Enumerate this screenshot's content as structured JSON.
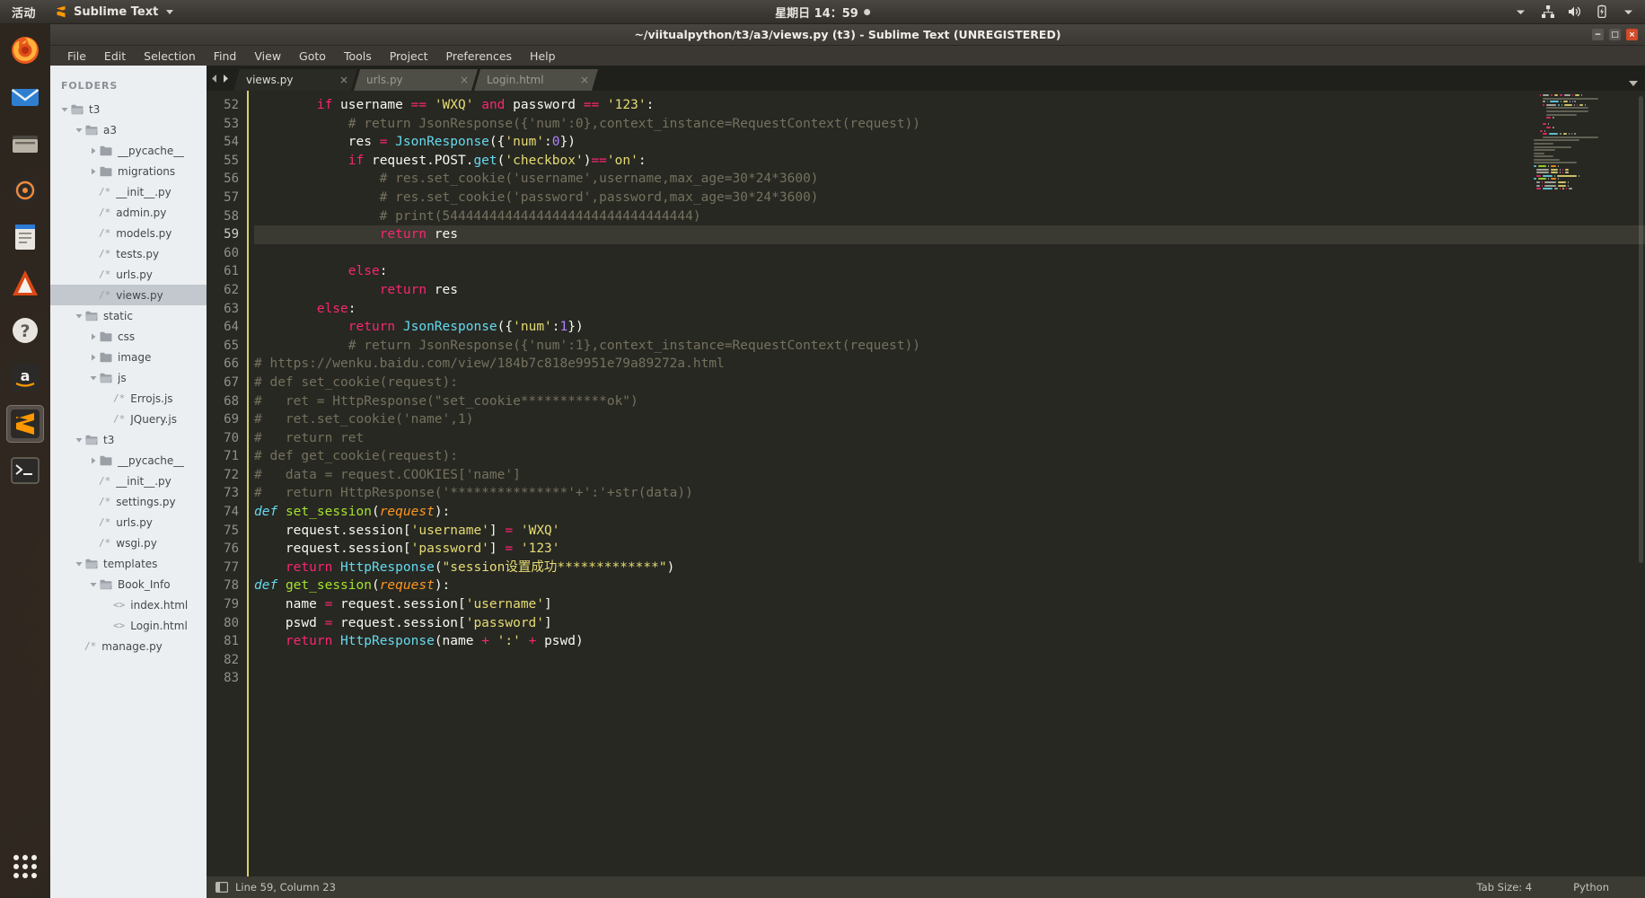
{
  "topbar": {
    "activities": "活动",
    "app_name": "Sublime Text",
    "clock": "星期日 14：59",
    "tray": [
      "chevron-down-icon",
      "network-icon",
      "volume-icon",
      "battery-icon",
      "chevron-down-icon"
    ]
  },
  "dock": {
    "items": [
      {
        "name": "firefox",
        "label": "Firefox"
      },
      {
        "name": "thunderbird",
        "label": "Thunderbird Mail"
      },
      {
        "name": "files",
        "label": "Files"
      },
      {
        "name": "rhythmbox",
        "label": "Rhythmbox"
      },
      {
        "name": "libreoffice-writer",
        "label": "LibreOffice Writer"
      },
      {
        "name": "ubuntu-software",
        "label": "Ubuntu Software"
      },
      {
        "name": "help",
        "label": "Help"
      },
      {
        "name": "amazon",
        "label": "Amazon"
      },
      {
        "name": "sublime-text",
        "label": "Sublime Text"
      },
      {
        "name": "terminal",
        "label": "Terminal"
      }
    ],
    "show_apps": "Show Applications"
  },
  "window": {
    "title": "~/viitualpython/t3/a3/views.py (t3) - Sublime Text (UNREGISTERED)",
    "minimize": "−",
    "maximize": "□",
    "close": "×"
  },
  "menu": [
    "File",
    "Edit",
    "Selection",
    "Find",
    "View",
    "Goto",
    "Tools",
    "Project",
    "Preferences",
    "Help"
  ],
  "sidebar": {
    "heading": "FOLDERS",
    "items": [
      {
        "label": "t3",
        "indent": 0,
        "type": "folder-open"
      },
      {
        "label": "a3",
        "indent": 1,
        "type": "folder-open"
      },
      {
        "label": "__pycache__",
        "indent": 2,
        "type": "folder"
      },
      {
        "label": "migrations",
        "indent": 2,
        "type": "folder"
      },
      {
        "label": "__init__.py",
        "indent": 2,
        "type": "file"
      },
      {
        "label": "admin.py",
        "indent": 2,
        "type": "file"
      },
      {
        "label": "models.py",
        "indent": 2,
        "type": "file"
      },
      {
        "label": "tests.py",
        "indent": 2,
        "type": "file"
      },
      {
        "label": "urls.py",
        "indent": 2,
        "type": "file"
      },
      {
        "label": "views.py",
        "indent": 2,
        "type": "file",
        "selected": true
      },
      {
        "label": "static",
        "indent": 1,
        "type": "folder-open"
      },
      {
        "label": "css",
        "indent": 2,
        "type": "folder"
      },
      {
        "label": "image",
        "indent": 2,
        "type": "folder"
      },
      {
        "label": "js",
        "indent": 2,
        "type": "folder-open"
      },
      {
        "label": "Errojs.js",
        "indent": 3,
        "type": "file"
      },
      {
        "label": "JQuery.js",
        "indent": 3,
        "type": "file"
      },
      {
        "label": "t3",
        "indent": 1,
        "type": "folder-open"
      },
      {
        "label": "__pycache__",
        "indent": 2,
        "type": "folder"
      },
      {
        "label": "__init__.py",
        "indent": 2,
        "type": "file"
      },
      {
        "label": "settings.py",
        "indent": 2,
        "type": "file"
      },
      {
        "label": "urls.py",
        "indent": 2,
        "type": "file"
      },
      {
        "label": "wsgi.py",
        "indent": 2,
        "type": "file"
      },
      {
        "label": "templates",
        "indent": 1,
        "type": "folder-open"
      },
      {
        "label": "Book_Info",
        "indent": 2,
        "type": "folder-open"
      },
      {
        "label": "index.html",
        "indent": 3,
        "type": "html"
      },
      {
        "label": "Login.html",
        "indent": 3,
        "type": "html"
      },
      {
        "label": "manage.py",
        "indent": 1,
        "type": "file"
      }
    ]
  },
  "tabs": [
    {
      "label": "views.py",
      "active": true,
      "close": "×"
    },
    {
      "label": "urls.py",
      "active": false,
      "close": "×"
    },
    {
      "label": "Login.html",
      "active": false,
      "close": "×"
    }
  ],
  "editor": {
    "first_line": 52,
    "cursor_line": 59,
    "lines": [
      {
        "n": 52,
        "tokens": [
          {
            "t": "        ",
            "c": "pl"
          },
          {
            "t": "if",
            "c": "k"
          },
          {
            "t": " username ",
            "c": "pl"
          },
          {
            "t": "==",
            "c": "op"
          },
          {
            "t": " ",
            "c": "pl"
          },
          {
            "t": "'WXQ'",
            "c": "str"
          },
          {
            "t": " ",
            "c": "pl"
          },
          {
            "t": "and",
            "c": "k"
          },
          {
            "t": " password ",
            "c": "pl"
          },
          {
            "t": "==",
            "c": "op"
          },
          {
            "t": " ",
            "c": "pl"
          },
          {
            "t": "'123'",
            "c": "str"
          },
          {
            "t": ":",
            "c": "pl"
          }
        ]
      },
      {
        "n": 53,
        "tokens": [
          {
            "t": "            # return JsonResponse({'num':0},context_instance=RequestContext(request))",
            "c": "cmt"
          }
        ]
      },
      {
        "n": 54,
        "tokens": [
          {
            "t": "            res ",
            "c": "pl"
          },
          {
            "t": "=",
            "c": "op"
          },
          {
            "t": " ",
            "c": "pl"
          },
          {
            "t": "JsonResponse",
            "c": "cls"
          },
          {
            "t": "({",
            "c": "pl"
          },
          {
            "t": "'num'",
            "c": "str"
          },
          {
            "t": ":",
            "c": "pl"
          },
          {
            "t": "0",
            "c": "num"
          },
          {
            "t": "})",
            "c": "pl"
          }
        ]
      },
      {
        "n": 55,
        "tokens": [
          {
            "t": "            ",
            "c": "pl"
          },
          {
            "t": "if",
            "c": "k"
          },
          {
            "t": " request.POST.",
            "c": "pl"
          },
          {
            "t": "get",
            "c": "cls"
          },
          {
            "t": "(",
            "c": "pl"
          },
          {
            "t": "'checkbox'",
            "c": "str"
          },
          {
            "t": ")",
            "c": "pl"
          },
          {
            "t": "==",
            "c": "op"
          },
          {
            "t": "'on'",
            "c": "str"
          },
          {
            "t": ":",
            "c": "pl"
          }
        ]
      },
      {
        "n": 56,
        "tokens": [
          {
            "t": "                # res.set_cookie('username',username,max_age=30*24*3600)",
            "c": "cmt"
          }
        ]
      },
      {
        "n": 57,
        "tokens": [
          {
            "t": "                # res.set_cookie('password',password,max_age=30*24*3600)",
            "c": "cmt"
          }
        ]
      },
      {
        "n": 58,
        "tokens": [
          {
            "t": "                # print(54444444444444444444444444444444)",
            "c": "cmt"
          }
        ]
      },
      {
        "n": 59,
        "hl": true,
        "tokens": [
          {
            "t": "                ",
            "c": "pl"
          },
          {
            "t": "return",
            "c": "k"
          },
          {
            "t": " res",
            "c": "pl"
          }
        ]
      },
      {
        "n": 60,
        "tokens": []
      },
      {
        "n": 61,
        "tokens": [
          {
            "t": "            ",
            "c": "pl"
          },
          {
            "t": "else",
            "c": "k"
          },
          {
            "t": ":",
            "c": "pl"
          }
        ]
      },
      {
        "n": 62,
        "tokens": [
          {
            "t": "                ",
            "c": "pl"
          },
          {
            "t": "return",
            "c": "k"
          },
          {
            "t": " res",
            "c": "pl"
          }
        ]
      },
      {
        "n": 63,
        "tokens": [
          {
            "t": "        ",
            "c": "pl"
          },
          {
            "t": "else",
            "c": "k"
          },
          {
            "t": ":",
            "c": "pl"
          }
        ]
      },
      {
        "n": 64,
        "tokens": [
          {
            "t": "            ",
            "c": "pl"
          },
          {
            "t": "return",
            "c": "k"
          },
          {
            "t": " ",
            "c": "pl"
          },
          {
            "t": "JsonResponse",
            "c": "cls"
          },
          {
            "t": "({",
            "c": "pl"
          },
          {
            "t": "'num'",
            "c": "str"
          },
          {
            "t": ":",
            "c": "pl"
          },
          {
            "t": "1",
            "c": "num"
          },
          {
            "t": "})",
            "c": "pl"
          }
        ]
      },
      {
        "n": 65,
        "tokens": [
          {
            "t": "            # return JsonResponse({'num':1},context_instance=RequestContext(request))",
            "c": "cmt"
          }
        ]
      },
      {
        "n": 66,
        "tokens": [
          {
            "t": "# https://wenku.baidu.com/view/184b7c818e9951e79a89272a.html",
            "c": "cmt"
          }
        ]
      },
      {
        "n": 67,
        "tokens": [
          {
            "t": "# def set_cookie(request):",
            "c": "cmt"
          }
        ]
      },
      {
        "n": 68,
        "tokens": [
          {
            "t": "#   ret = HttpResponse(\"set_cookie***********ok\")",
            "c": "cmt"
          }
        ]
      },
      {
        "n": 69,
        "tokens": [
          {
            "t": "#   ret.set_cookie('name',1)",
            "c": "cmt"
          }
        ]
      },
      {
        "n": 70,
        "tokens": [
          {
            "t": "#   return ret",
            "c": "cmt"
          }
        ]
      },
      {
        "n": 71,
        "tokens": [
          {
            "t": "# def get_cookie(request):",
            "c": "cmt"
          }
        ]
      },
      {
        "n": 72,
        "tokens": [
          {
            "t": "#   data = request.COOKIES['name']",
            "c": "cmt"
          }
        ]
      },
      {
        "n": 73,
        "tokens": [
          {
            "t": "#   return HttpResponse('***************'+':'+str(data))",
            "c": "cmt"
          }
        ]
      },
      {
        "n": 74,
        "tokens": [
          {
            "t": "def",
            "c": "kw2"
          },
          {
            "t": " ",
            "c": "pl"
          },
          {
            "t": "set_session",
            "c": "fn"
          },
          {
            "t": "(",
            "c": "pl"
          },
          {
            "t": "request",
            "c": "par"
          },
          {
            "t": "):",
            "c": "pl"
          }
        ]
      },
      {
        "n": 75,
        "tokens": [
          {
            "t": "    request.session[",
            "c": "pl"
          },
          {
            "t": "'username'",
            "c": "str"
          },
          {
            "t": "] ",
            "c": "pl"
          },
          {
            "t": "=",
            "c": "op"
          },
          {
            "t": " ",
            "c": "pl"
          },
          {
            "t": "'WXQ'",
            "c": "str"
          }
        ]
      },
      {
        "n": 76,
        "tokens": [
          {
            "t": "    request.session[",
            "c": "pl"
          },
          {
            "t": "'password'",
            "c": "str"
          },
          {
            "t": "] ",
            "c": "pl"
          },
          {
            "t": "=",
            "c": "op"
          },
          {
            "t": " ",
            "c": "pl"
          },
          {
            "t": "'123'",
            "c": "str"
          }
        ]
      },
      {
        "n": 77,
        "tokens": [
          {
            "t": "    ",
            "c": "pl"
          },
          {
            "t": "return",
            "c": "k"
          },
          {
            "t": " ",
            "c": "pl"
          },
          {
            "t": "HttpResponse",
            "c": "cls"
          },
          {
            "t": "(",
            "c": "pl"
          },
          {
            "t": "\"session设置成功*************\"",
            "c": "str"
          },
          {
            "t": ")",
            "c": "pl"
          }
        ]
      },
      {
        "n": 78,
        "tokens": [
          {
            "t": "def",
            "c": "kw2"
          },
          {
            "t": " ",
            "c": "pl"
          },
          {
            "t": "get_session",
            "c": "fn"
          },
          {
            "t": "(",
            "c": "pl"
          },
          {
            "t": "request",
            "c": "par"
          },
          {
            "t": "):",
            "c": "pl"
          }
        ]
      },
      {
        "n": 79,
        "tokens": [
          {
            "t": "    name ",
            "c": "pl"
          },
          {
            "t": "=",
            "c": "op"
          },
          {
            "t": " request.session[",
            "c": "pl"
          },
          {
            "t": "'username'",
            "c": "str"
          },
          {
            "t": "]",
            "c": "pl"
          }
        ]
      },
      {
        "n": 80,
        "tokens": [
          {
            "t": "    pswd ",
            "c": "pl"
          },
          {
            "t": "=",
            "c": "op"
          },
          {
            "t": " request.session[",
            "c": "pl"
          },
          {
            "t": "'password'",
            "c": "str"
          },
          {
            "t": "]",
            "c": "pl"
          }
        ]
      },
      {
        "n": 81,
        "tokens": [
          {
            "t": "    ",
            "c": "pl"
          },
          {
            "t": "return",
            "c": "k"
          },
          {
            "t": " ",
            "c": "pl"
          },
          {
            "t": "HttpResponse",
            "c": "cls"
          },
          {
            "t": "(name ",
            "c": "pl"
          },
          {
            "t": "+",
            "c": "op"
          },
          {
            "t": " ",
            "c": "pl"
          },
          {
            "t": "':'",
            "c": "str"
          },
          {
            "t": " ",
            "c": "pl"
          },
          {
            "t": "+",
            "c": "op"
          },
          {
            "t": " pswd)",
            "c": "pl"
          }
        ]
      },
      {
        "n": 82,
        "tokens": []
      },
      {
        "n": 83,
        "tokens": []
      }
    ]
  },
  "statusbar": {
    "position": "Line 59, Column 23",
    "tab_size": "Tab Size: 4",
    "syntax": "Python"
  },
  "colors": {
    "bg_editor": "#272822",
    "accent_keyword": "#f92672",
    "accent_string": "#e6db74",
    "accent_comment": "#75715e",
    "accent_class": "#66d9ef",
    "accent_function": "#a6e22e",
    "accent_number": "#ae81ff",
    "gutter_rule": "#d6d16b",
    "sidebar_bg": "#eceff1"
  }
}
